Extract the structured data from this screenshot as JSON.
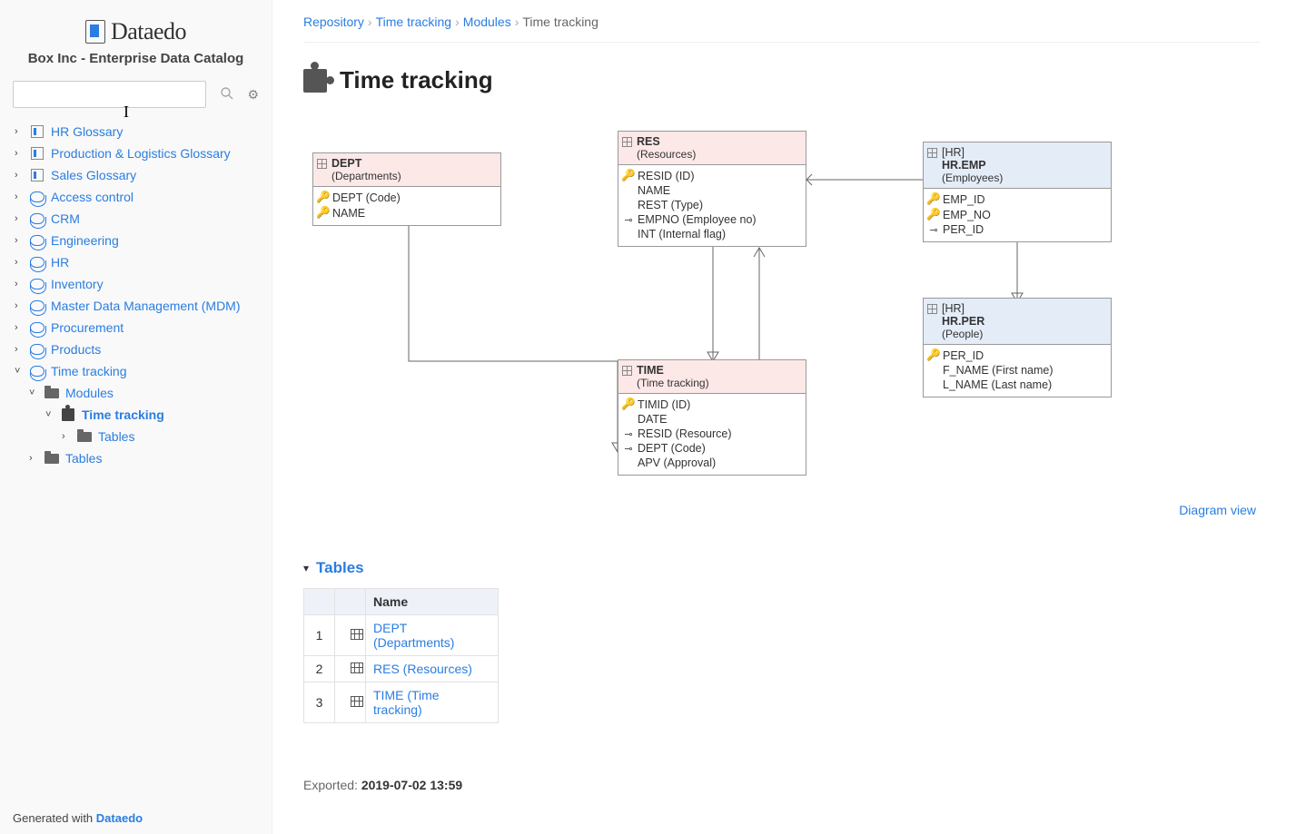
{
  "app": {
    "brand": "Dataedo",
    "repo_title": "Box Inc - Enterprise Data Catalog"
  },
  "search": {
    "placeholder": ""
  },
  "sidebar": {
    "items": [
      {
        "label": "HR Glossary",
        "icon": "book"
      },
      {
        "label": "Production & Logistics Glossary",
        "icon": "book"
      },
      {
        "label": "Sales Glossary",
        "icon": "book"
      },
      {
        "label": "Access control",
        "icon": "db"
      },
      {
        "label": "CRM",
        "icon": "db"
      },
      {
        "label": "Engineering",
        "icon": "db"
      },
      {
        "label": "HR",
        "icon": "db"
      },
      {
        "label": "Inventory",
        "icon": "db"
      },
      {
        "label": "Master Data Management (MDM)",
        "icon": "db"
      },
      {
        "label": "Procurement",
        "icon": "db"
      },
      {
        "label": "Products",
        "icon": "db"
      },
      {
        "label": "Time tracking",
        "icon": "db",
        "expanded": true
      }
    ],
    "time_tracking_children": {
      "modules": "Modules",
      "module_child": "Time tracking",
      "module_child_tables": "Tables",
      "tables": "Tables"
    }
  },
  "footer": {
    "prefix": "Generated with ",
    "brand": "Dataedo"
  },
  "breadcrumb": [
    {
      "label": "Repository",
      "link": true
    },
    {
      "label": "Time tracking",
      "link": true
    },
    {
      "label": "Modules",
      "link": true
    },
    {
      "label": "Time tracking",
      "link": false
    }
  ],
  "page": {
    "title": "Time tracking",
    "diagram_link": "Diagram view"
  },
  "entities": {
    "dept": {
      "name": "DEPT",
      "sub": "(Departments)",
      "cols": [
        {
          "icon": "key-gold",
          "text": "DEPT (Code)"
        },
        {
          "icon": "key-gold",
          "text": "NAME"
        }
      ]
    },
    "res": {
      "name": "RES",
      "sub": "(Resources)",
      "cols": [
        {
          "icon": "key-gold",
          "text": "RESID (ID)"
        },
        {
          "icon": "",
          "text": "NAME"
        },
        {
          "icon": "",
          "text": "REST (Type)"
        },
        {
          "icon": "fk",
          "text": "EMPNO (Employee no)"
        },
        {
          "icon": "",
          "text": "INT (Internal flag)"
        }
      ]
    },
    "hremp": {
      "schema": "[HR]",
      "name": "HR.EMP",
      "sub": "(Employees)",
      "cols": [
        {
          "icon": "key-gold",
          "text": "EMP_ID"
        },
        {
          "icon": "key-blue",
          "text": "EMP_NO"
        },
        {
          "icon": "fk",
          "text": "PER_ID"
        }
      ]
    },
    "time": {
      "name": "TIME",
      "sub": "(Time tracking)",
      "cols": [
        {
          "icon": "key-gold",
          "text": "TIMID (ID)"
        },
        {
          "icon": "",
          "text": "DATE"
        },
        {
          "icon": "fk",
          "text": "RESID (Resource)"
        },
        {
          "icon": "fk",
          "text": "DEPT (Code)"
        },
        {
          "icon": "",
          "text": "APV (Approval)"
        }
      ]
    },
    "hrper": {
      "schema": "[HR]",
      "name": "HR.PER",
      "sub": "(People)",
      "cols": [
        {
          "icon": "key-gold",
          "text": "PER_ID"
        },
        {
          "icon": "",
          "text": "F_NAME (First name)"
        },
        {
          "icon": "",
          "text": "L_NAME (Last name)"
        }
      ]
    }
  },
  "tables_section": {
    "title": "Tables",
    "header_name": "Name",
    "rows": [
      {
        "idx": "1",
        "label": "DEPT (Departments)"
      },
      {
        "idx": "2",
        "label": "RES (Resources)"
      },
      {
        "idx": "3",
        "label": "TIME (Time tracking)"
      }
    ]
  },
  "exported": {
    "prefix": "Exported: ",
    "value": "2019-07-02 13:59"
  }
}
